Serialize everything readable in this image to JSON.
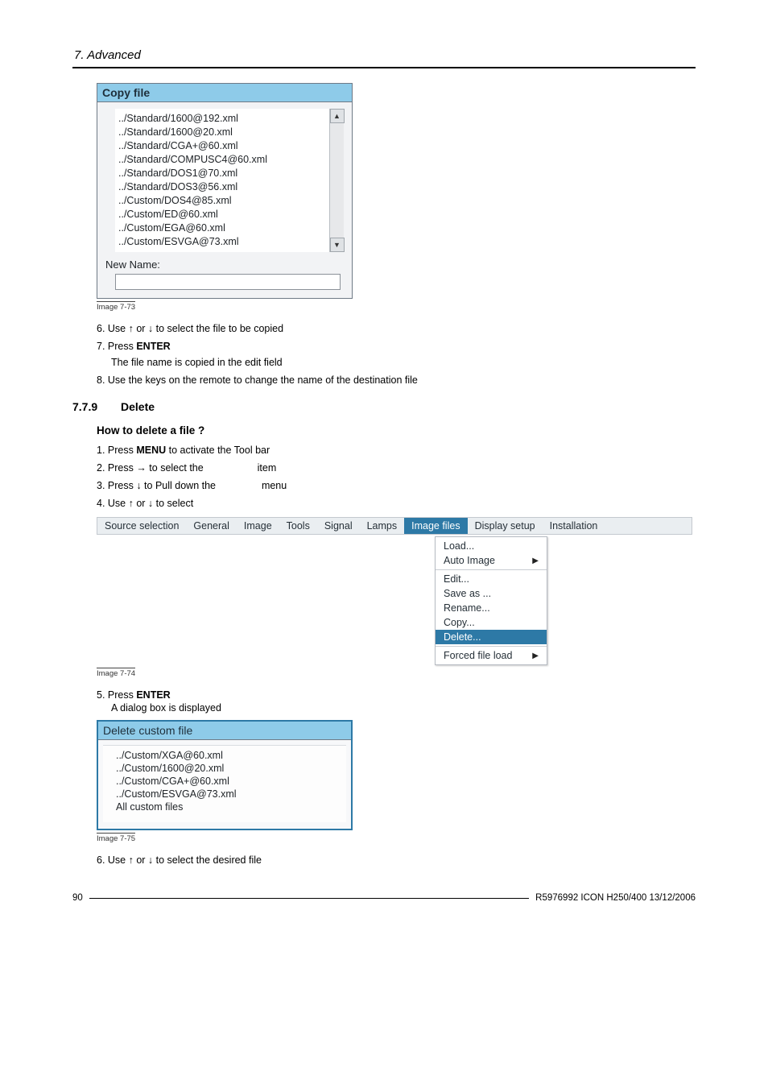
{
  "header": {
    "title": "7. Advanced"
  },
  "copy_dialog": {
    "title": "Copy file",
    "files": [
      "../Standard/1600@192.xml",
      "../Standard/1600@20.xml",
      "../Standard/CGA+@60.xml",
      "../Standard/COMPUSC4@60.xml",
      "../Standard/DOS1@70.xml",
      "../Standard/DOS3@56.xml",
      "../Custom/DOS4@85.xml",
      "../Custom/ED@60.xml",
      "../Custom/EGA@60.xml",
      "../Custom/ESVGA@73.xml"
    ],
    "new_name_label": "New Name:",
    "caption": "Image 7-73"
  },
  "steps_a": {
    "s6": "6. Use ↑ or ↓ to select the file to be copied",
    "s7_prefix": "7. Press ",
    "s7_bold": "ENTER",
    "s7_sub": "The file name is copied in the edit field",
    "s8": "8. Use the keys on the remote to change the name of the destination file"
  },
  "section": {
    "num": "7.7.9",
    "title": "Delete"
  },
  "subheading": "How to delete a file ?",
  "steps_b": {
    "s1_prefix": "1. Press ",
    "s1_bold": "MENU",
    "s1_suffix": " to activate the Tool bar",
    "s2": "2. Press → to select the ",
    "s2_suffix": " item",
    "s3": "3. Press ↓ to Pull down the ",
    "s3_suffix": " menu",
    "s4": "4. Use ↑ or ↓ to select"
  },
  "toolbar": {
    "items": [
      "Source selection",
      "General",
      "Image",
      "Tools",
      "Signal",
      "Lamps",
      "Image files",
      "Display setup",
      "Installation"
    ]
  },
  "dropdown": {
    "g1": [
      {
        "label": "Load...",
        "arrow": false
      },
      {
        "label": "Auto Image",
        "arrow": true
      }
    ],
    "g2": [
      {
        "label": "Edit...",
        "arrow": false
      },
      {
        "label": "Save as ...",
        "arrow": false
      },
      {
        "label": "Rename...",
        "arrow": false
      },
      {
        "label": "Copy...",
        "arrow": false
      },
      {
        "label": "Delete...",
        "arrow": false,
        "selected": true
      }
    ],
    "g3": [
      {
        "label": "Forced file load",
        "arrow": true
      }
    ]
  },
  "caption74": "Image 7-74",
  "steps_c": {
    "s5_prefix": "5. Press ",
    "s5_bold": "ENTER",
    "s5_sub": "A dialog box is displayed"
  },
  "delete_dialog": {
    "title": "Delete custom file",
    "files": [
      "../Custom/XGA@60.xml",
      "../Custom/1600@20.xml",
      "../Custom/CGA+@60.xml",
      "../Custom/ESVGA@73.xml",
      "All custom files"
    ],
    "caption": "Image 7-75"
  },
  "steps_d": {
    "s6": "6. Use ↑ or ↓ to select the desired file"
  },
  "footer": {
    "page": "90",
    "ref": "R5976992 ICON H250/400 13/12/2006"
  }
}
